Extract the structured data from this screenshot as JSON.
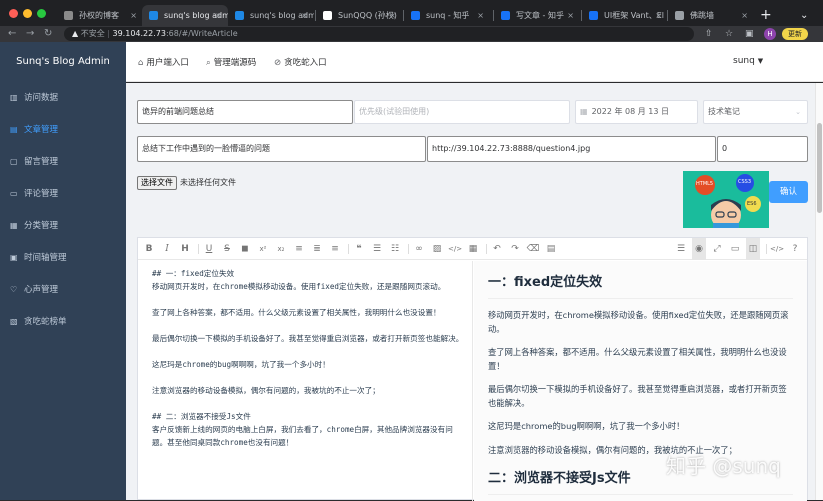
{
  "browser": {
    "tabs": [
      {
        "label": "孙权的博客",
        "favicon": "#8a8a8a"
      },
      {
        "label": "sunq's blog adm",
        "favicon": "#1e88e5"
      },
      {
        "label": "sunq's blog adm",
        "favicon": "#1e88e5"
      },
      {
        "label": "SunQQQ (孙权)",
        "favicon": "#ffffff"
      },
      {
        "label": "sunq - 知乎",
        "favicon": "#1772f6"
      },
      {
        "label": "写文章 - 知乎",
        "favicon": "#1772f6"
      },
      {
        "label": "UI框架 Vant、El",
        "favicon": "#1772f6"
      },
      {
        "label": "佛跳墙",
        "favicon": "#9aa0a6"
      }
    ],
    "address": {
      "insecure_label": "不安全",
      "host": "39.104.22.73",
      "path": ":68/#/WriteArticle"
    },
    "profile_initial": "H",
    "update_label": "更新"
  },
  "sidebar": {
    "app_title": "Sunq's Blog Admin",
    "items": [
      {
        "label": "访问数据",
        "icon": "data-icon"
      },
      {
        "label": "文章管理",
        "icon": "article-icon"
      },
      {
        "label": "留言管理",
        "icon": "message-icon"
      },
      {
        "label": "评论管理",
        "icon": "comment-icon"
      },
      {
        "label": "分类管理",
        "icon": "category-icon"
      },
      {
        "label": "时间轴管理",
        "icon": "timeline-icon"
      },
      {
        "label": "心声管理",
        "icon": "voice-icon"
      },
      {
        "label": "贪吃蛇榜单",
        "icon": "ranking-icon"
      }
    ],
    "active_index": 1
  },
  "header": {
    "links": [
      {
        "label": "用户端入口",
        "icon": "home-icon"
      },
      {
        "label": "管理端源码",
        "icon": "code-icon"
      },
      {
        "label": "贪吃蛇入口",
        "icon": "link-icon"
      }
    ],
    "username": "sunq"
  },
  "form": {
    "title_value": "诡异的前端问题总结",
    "priority_placeholder": "优先级(试验田使用)",
    "date_value": "2022 年 08 月 13 日",
    "category_value": "技术笔记",
    "summary_value": "总结下工作中遇到的一脸懵逼的问题",
    "image_url": "http://39.104.22.73:8888/question4.jpg",
    "number_value": "0",
    "file_button": "选择文件",
    "file_status": "未选择任何文件",
    "confirm_label": "确认",
    "cover_badges": [
      "HTML5",
      "CSS3",
      "ES6"
    ]
  },
  "editor": {
    "source_lines": [
      {
        "text": "## 一：fixed定位失效",
        "gap": false
      },
      {
        "text": "移动网页开发时，在chrome模拟移动设备。使用fixed定位失败，还是跟随网页滚动。",
        "gap": true
      },
      {
        "text": "查了网上各种答案，都不适用。什么父级元素设置了相关属性，我明明什么也没设置！",
        "gap": true
      },
      {
        "text": "最后偶尔切换一下模拟的手机设备好了。我甚至觉得重启浏览器，或者打开新页签也能解决。",
        "gap": true
      },
      {
        "text": "这尼玛是chrome的bug啊啊啊，坑了我一个多小时！",
        "gap": true
      },
      {
        "text": "注意浏览器的移动设备模拟，偶尔有问题的，我被坑的不止一次了；",
        "gap": true
      },
      {
        "text": "## 二：浏览器不接受Js文件",
        "gap": false
      },
      {
        "text": "客户反馈新上线的网页的电脑上白屏，我们去看了，chrome白屏，其他品牌浏览器没有问题。甚至他同桌同款chrome也没有问题！",
        "gap": true
      }
    ],
    "preview": {
      "h1": "一：fixed定位失效",
      "paragraphs": [
        "移动网页开发时，在chrome模拟移动设备。使用fixed定位失败，还是跟随网页滚动。",
        "查了网上各种答案，都不适用。什么父级元素设置了相关属性，我明明什么也没设置！",
        "最后偶尔切换一下模拟的手机设备好了。我甚至觉得重启浏览器，或者打开新页签也能解决。",
        "这尼玛是chrome的bug啊啊啊，坑了我一个多小时！",
        "注意浏览器的移动设备模拟，偶尔有问题的，我被坑的不止一次了；"
      ],
      "h2": "二：浏览器不接受Js文件"
    }
  },
  "watermark": "知乎 @sunq"
}
